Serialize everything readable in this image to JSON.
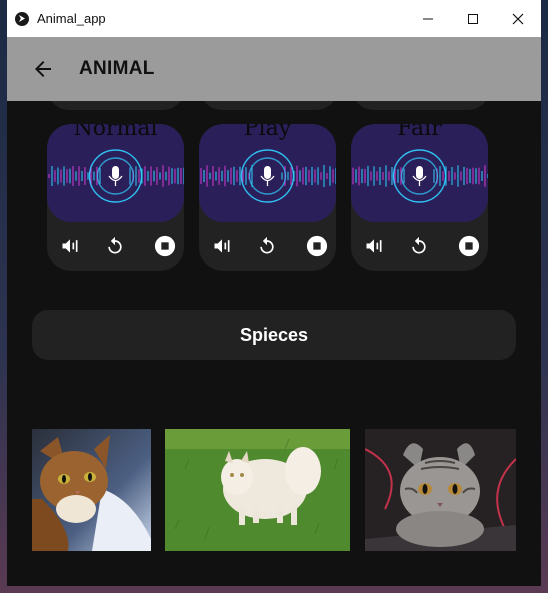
{
  "window": {
    "title": "Animal_app",
    "controls": [
      "minimize",
      "maximize",
      "close"
    ]
  },
  "appbar": {
    "title": "ANIMAL",
    "back_icon": "arrow-back-icon"
  },
  "sound_cards": [
    {
      "label": "Normal",
      "controls": [
        "volume-icon",
        "replay-icon",
        "stop-icon"
      ]
    },
    {
      "label": "Play",
      "controls": [
        "volume-icon",
        "replay-icon",
        "stop-icon"
      ]
    },
    {
      "label": "Fair",
      "controls": [
        "volume-icon",
        "replay-icon",
        "stop-icon"
      ]
    }
  ],
  "species": {
    "label": "Spieces"
  },
  "photos": [
    {
      "subject": "abyssinian-cat"
    },
    {
      "subject": "white-fluffy-cat-on-grass"
    },
    {
      "subject": "american-curl-tabby-cat"
    }
  ],
  "colors": {
    "appbar": "#9b9b9b",
    "background": "#111111",
    "card": "#222222",
    "wave_bg": "#2b1f5a",
    "wave_cyan": "#2fd0ff",
    "wave_magenta": "#d43bd2"
  }
}
